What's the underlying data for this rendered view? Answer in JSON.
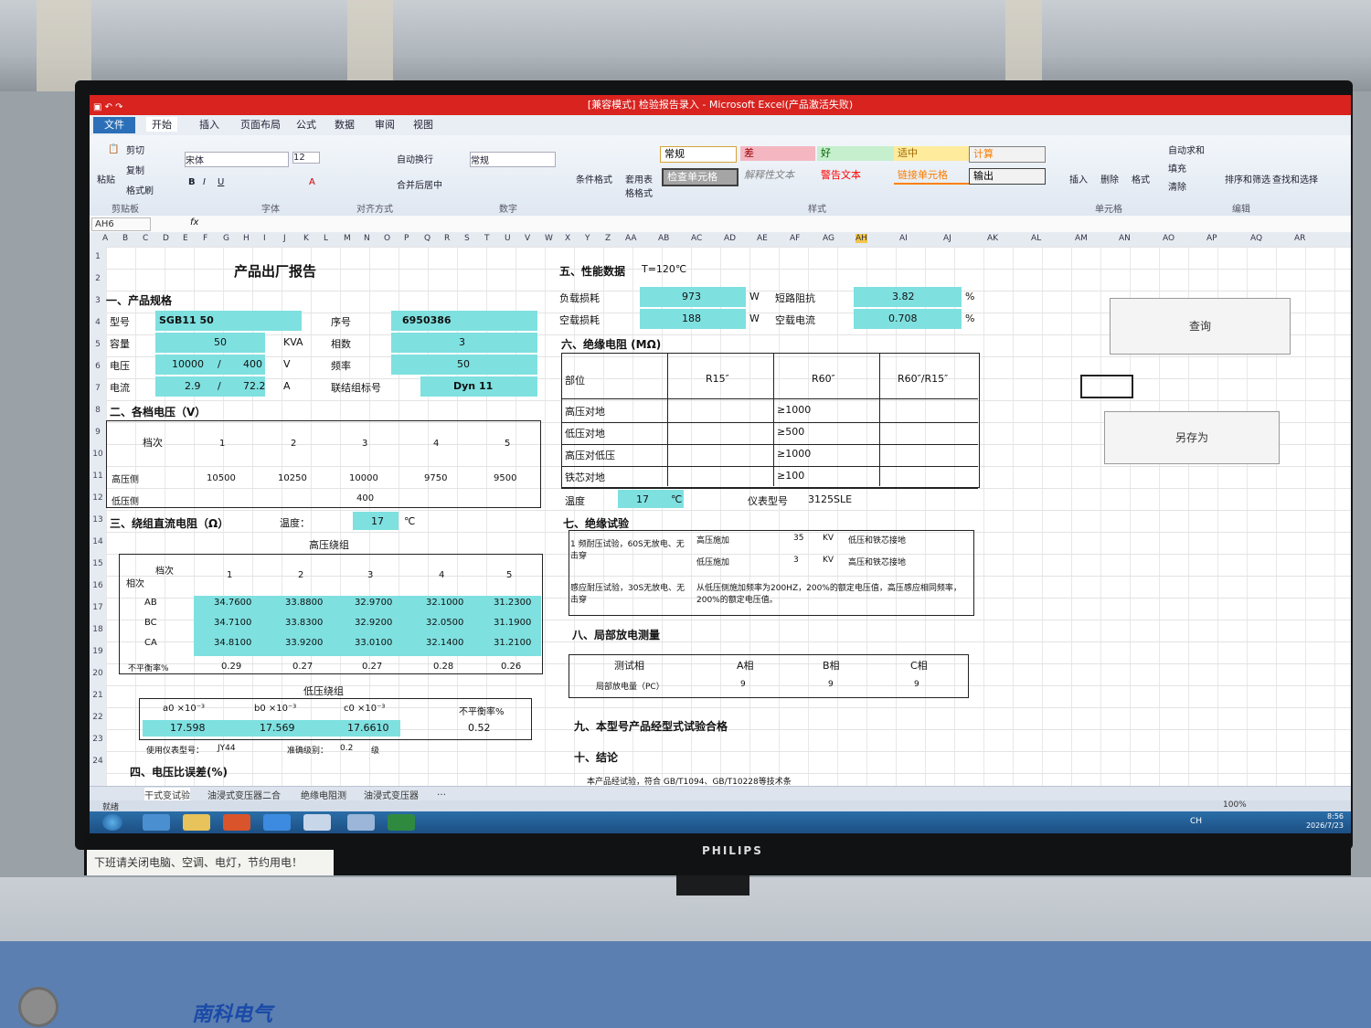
{
  "window": {
    "title": "[兼容模式] 检验报告录入 - Microsoft Excel(产品激活失败)"
  },
  "ribbon": {
    "file": "文件",
    "tabs": [
      "开始",
      "插入",
      "页面布局",
      "公式",
      "数据",
      "审阅",
      "视图"
    ],
    "clipboard": {
      "paste": "粘贴",
      "cut": "剪切",
      "copy": "复制",
      "format_painter": "格式刷",
      "group": "剪贴板"
    },
    "font": {
      "name": "宋体",
      "size": "12",
      "group": "字体"
    },
    "alignment": {
      "wrap": "自动换行",
      "merge": "合并后居中",
      "group": "对齐方式"
    },
    "number": {
      "format": "常规",
      "group": "数字"
    },
    "styles": {
      "cond_format": "条件格式",
      "table_format": "套用表格格式",
      "normal": "常规",
      "bad": "差",
      "good": "好",
      "neutral": "适中",
      "calc": "计算",
      "check": "检查单元格",
      "explain": "解释性文本",
      "warning": "警告文本",
      "link": "链接单元格",
      "output": "输出",
      "group": "样式"
    },
    "cells": {
      "insert": "插入",
      "delete": "删除",
      "format": "格式",
      "group": "单元格"
    },
    "editing": {
      "autosum": "自动求和",
      "fill": "填充",
      "clear": "清除",
      "sort": "排序和筛选",
      "find": "查找和选择",
      "group": "编辑"
    }
  },
  "formula_bar": {
    "name_box": "AH6",
    "fx": "fx"
  },
  "columns": [
    "A",
    "B",
    "C",
    "D",
    "E",
    "F",
    "G",
    "H",
    "I",
    "J",
    "K",
    "L",
    "M",
    "N",
    "O",
    "P",
    "Q",
    "R",
    "S",
    "T",
    "U",
    "V",
    "W",
    "X",
    "Y",
    "Z",
    "AA",
    "AB",
    "AC",
    "AD",
    "AE",
    "AF",
    "AG",
    "AH",
    "AI",
    "AJ",
    "AK",
    "AL",
    "AM",
    "AN",
    "AO",
    "AP",
    "AQ",
    "AR"
  ],
  "rows": [
    "1",
    "2",
    "3",
    "4",
    "5",
    "6",
    "7",
    "8",
    "9",
    "10",
    "11",
    "12",
    "13",
    "14",
    "15",
    "16",
    "17",
    "18",
    "19",
    "20",
    "21",
    "22",
    "23",
    "24"
  ],
  "report": {
    "title": "产品出厂报告",
    "s1": {
      "heading": "一、产品规格",
      "model_label": "型号",
      "model": "SGB11 50",
      "serial_label": "序号",
      "serial": "6950386",
      "capacity_label": "容量",
      "capacity": "50",
      "capacity_unit": "KVA",
      "phase_label": "相数",
      "phase": "3",
      "voltage_label": "电压",
      "voltage_hv": "10000",
      "slash": "/",
      "voltage_lv": "400",
      "voltage_unit": "V",
      "freq_label": "频率",
      "freq": "50",
      "current_label": "电流",
      "current_hv": "2.9",
      "current_lv": "72.2",
      "current_unit": "A",
      "vector_label": "联结组标号",
      "vector": "Dyn 11"
    },
    "s2": {
      "heading": "二、各档电压（V）",
      "corner": "档次",
      "taps": [
        "1",
        "2",
        "3",
        "4",
        "5"
      ],
      "hv_label": "高压侧",
      "hv": [
        "10500",
        "10250",
        "10000",
        "9750",
        "9500"
      ],
      "lv_label": "低压侧",
      "lv": "400"
    },
    "s3": {
      "heading": "三、绕组直流电阻（Ω）",
      "temp_label": "温度：",
      "temp": "17",
      "temp_unit": "℃",
      "hv_heading": "高压绕组",
      "corner_top": "档次",
      "corner_bottom": "相次",
      "taps": [
        "1",
        "2",
        "3",
        "4",
        "5"
      ],
      "rows": [
        {
          "phase": "AB",
          "values": [
            "34.7600",
            "33.8800",
            "32.9700",
            "32.1000",
            "31.2300"
          ]
        },
        {
          "phase": "BC",
          "values": [
            "34.7100",
            "33.8300",
            "32.9200",
            "32.0500",
            "31.1900"
          ]
        },
        {
          "phase": "CA",
          "values": [
            "34.8100",
            "33.9200",
            "33.0100",
            "32.1400",
            "31.2100"
          ]
        }
      ],
      "unbalance_label": "不平衡率%",
      "unbalance": [
        "0.29",
        "0.27",
        "0.27",
        "0.28",
        "0.26"
      ],
      "lv_heading": "低压绕组",
      "lv_headers": [
        "a0 ×10⁻³",
        "b0 ×10⁻³",
        "c0 ×10⁻³",
        "不平衡率%"
      ],
      "lv_values": [
        "17.598",
        "17.569",
        "17.6610",
        "0.52"
      ],
      "instrument_label": "使用仪表型号：",
      "instrument": "JY44",
      "accuracy_label": "准确级别：",
      "accuracy": "0.2",
      "accuracy_unit": "级"
    },
    "s4": {
      "heading": "四、电压比误差(%)"
    },
    "s5": {
      "heading": "五、性能数据",
      "temp": "T=120℃",
      "load_loss_label": "负载损耗",
      "load_loss": "973",
      "load_loss_unit": "W",
      "sc_label": "短路阻抗",
      "sc": "3.82",
      "sc_unit": "%",
      "noload_loss_label": "空载损耗",
      "noload_loss": "188",
      "noload_loss_unit": "W",
      "noload_cur_label": "空载电流",
      "noload_cur": "0.708",
      "noload_cur_unit": "%"
    },
    "s6": {
      "heading": "六、绝缘电阻 (MΩ)",
      "corner": "部位",
      "cols": [
        "R15″",
        "R60″",
        "R60″/R15″"
      ],
      "rows": [
        {
          "part": "高压对地",
          "r60": "≥1000"
        },
        {
          "part": "低压对地",
          "r60": "≥500"
        },
        {
          "part": "高压对低压",
          "r60": "≥1000"
        },
        {
          "part": "铁芯对地",
          "r60": "≥100"
        }
      ],
      "temp_label": "温度",
      "temp": "17",
      "temp_unit": "℃",
      "instr_label": "仪表型号",
      "instr": "3125SLE"
    },
    "s7": {
      "heading": "七、绝缘试验",
      "applied_label": "1 频耐压试验，60S无放电、无击穿",
      "hv_applied_label": "高压施加",
      "hv_applied": "35",
      "hv_applied_unit": "KV",
      "hv_applied_note": "低压和铁芯接地",
      "lv_applied_label": "低压施加",
      "lv_applied": "3",
      "lv_applied_unit": "KV",
      "lv_applied_note": "高压和铁芯接地",
      "induced_label": "感应耐压试验，30S无放电、无击穿",
      "induced_note": "从低压侧施加频率为200HZ，200%的额定电压值，高压感应相同频率，200%的额定电压值。"
    },
    "s8": {
      "heading": "八、局部放电测量",
      "cols": [
        "测试相",
        "A相",
        "B相",
        "C相"
      ],
      "row_label": "局部放电量（PC）",
      "values": [
        "9",
        "9",
        "9"
      ]
    },
    "s9": {
      "heading": "九、本型号产品经型式试验合格"
    },
    "s10": {
      "heading": "十、结论",
      "text": "本产品经试验，符合 GB/T1094、GB/T10228等技术条"
    }
  },
  "buttons": {
    "query": "查询",
    "save_as": "另存为"
  },
  "sheet_tabs": [
    "干式变试验",
    "油浸式变压器二合",
    "绝缘电阻测",
    "油浸式变压器",
    "…"
  ],
  "status": {
    "ready": "就绪",
    "zoom": "100%"
  },
  "taskbar": {
    "time": "8:56",
    "date": "2026/7/23",
    "lang": "CH"
  },
  "desk_notice": "下班请关闭电脑、空调、电灯，节约用电！",
  "monitor_brand": "PHILIPS",
  "desk_logo": "南科电气"
}
